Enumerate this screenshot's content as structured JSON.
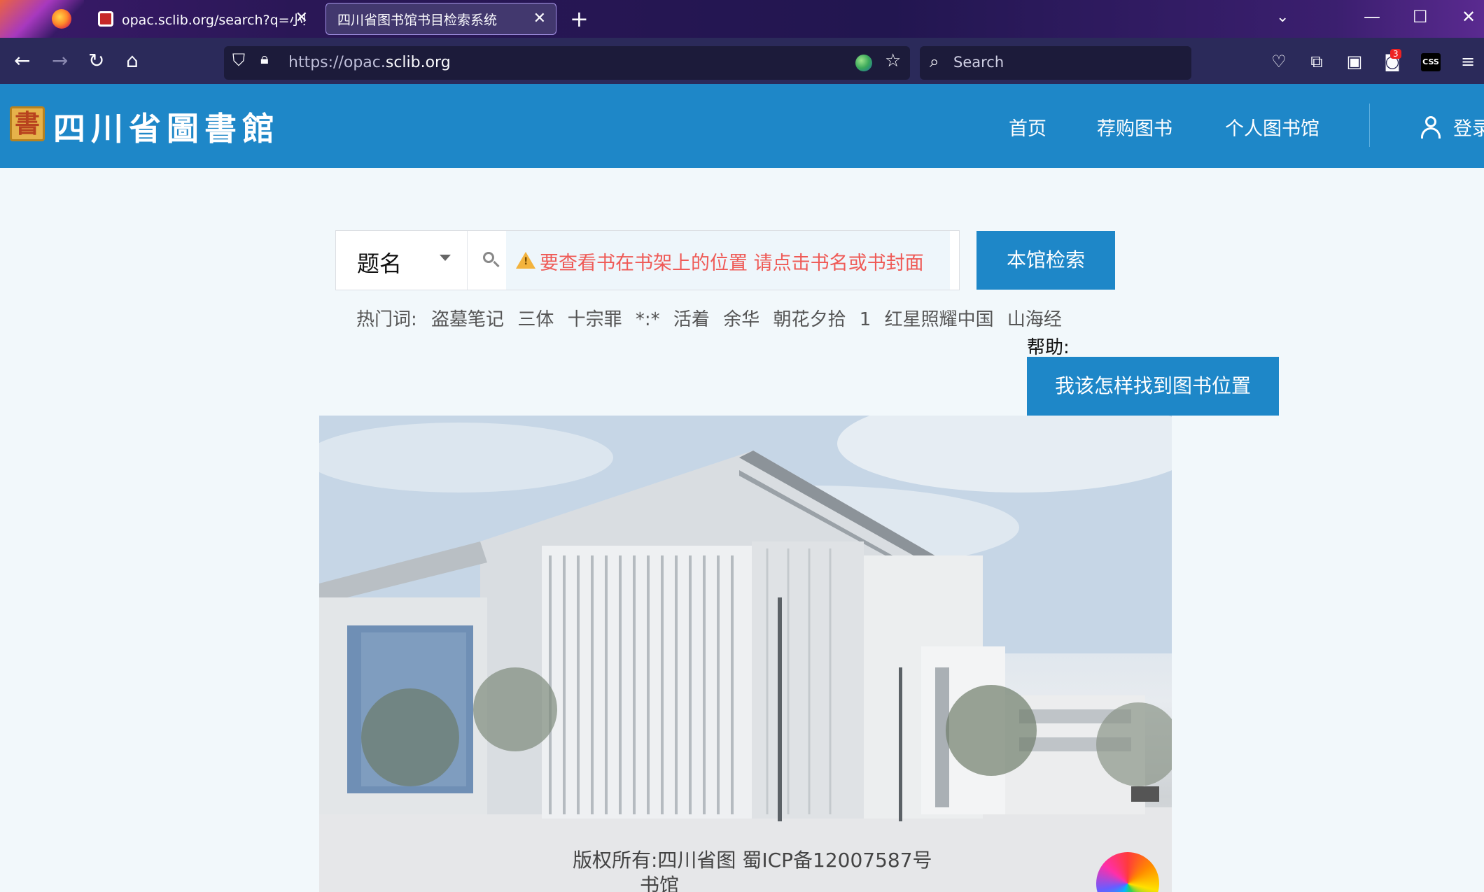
{
  "browser": {
    "tabs": [
      {
        "title": "opac.sclib.org/search?q=小柴昌",
        "active": false
      },
      {
        "title": "四川省图书馆书目检索系统",
        "active": true
      }
    ],
    "url_prefix": "https://opac.",
    "url_domain": "sclib.org",
    "search_placeholder": "Search",
    "extension_badge": "3",
    "css_ext_label": "CSS"
  },
  "site": {
    "logo_seal": "書",
    "logo_text": "四川省圖書館",
    "nav": [
      "首页",
      "荐购图书",
      "个人图书馆"
    ],
    "login": "登录"
  },
  "search": {
    "type_selected": "题名",
    "hint": "要查看书在书架上的位置 请点击书名或书封面",
    "button": "本馆检索"
  },
  "hot": {
    "label": "热门词:",
    "keywords": [
      "盗墓笔记",
      "三体",
      "十宗罪",
      "*:*",
      "活着",
      "余华",
      "朝花夕拾",
      "1",
      "红星照耀中国",
      "山海经"
    ]
  },
  "help": {
    "label": "帮助:",
    "button": "我该怎样找到图书位置"
  },
  "footer": {
    "line1": "版权所有:四川省图 蜀ICP备12007587号",
    "line2": "书馆"
  },
  "colors": {
    "brand_blue": "#1e87c8",
    "hint_red": "#ef5a56",
    "page_bg": "#f2f8fb"
  }
}
